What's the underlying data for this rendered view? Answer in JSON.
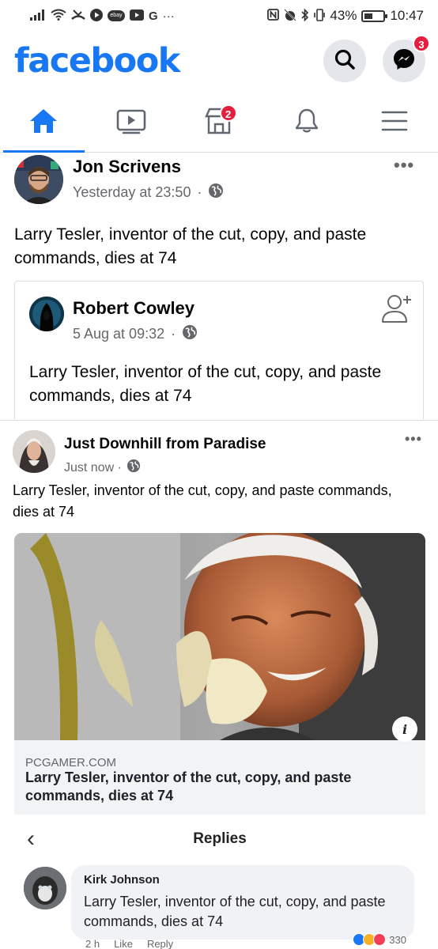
{
  "status_bar": {
    "battery": "43%",
    "time": "10:47",
    "battery_level": 0.43,
    "notification_pill": "ebay",
    "more": "···"
  },
  "header": {
    "logo": "facebook",
    "messenger_badge": "3",
    "brand_color": "#1877f2",
    "badge_color": "#e41e3f"
  },
  "nav": {
    "tabs": [
      {
        "icon": "home-icon",
        "active": true
      },
      {
        "icon": "watch-icon",
        "active": false
      },
      {
        "icon": "marketplace-icon",
        "active": false,
        "badge": "2"
      },
      {
        "icon": "bell-icon",
        "active": false
      },
      {
        "icon": "menu-icon",
        "active": false
      }
    ]
  },
  "post1": {
    "author": "Jon Scrivens",
    "timestamp": "Yesterday at 23:50",
    "dot": "·",
    "text": "Larry Tesler, inventor of the cut, copy, and paste commands, dies at 74",
    "more": "•••"
  },
  "shared": {
    "author": "Robert Cowley",
    "timestamp": "5 Aug at 09:32",
    "dot": "·",
    "text": "Larry Tesler, inventor of the cut, copy, and paste commands, dies at 74"
  },
  "post2": {
    "author": "Just Downhill from Paradise",
    "timestamp": "Just now ·",
    "text": "Larry Tesler, inventor of the cut, copy, and paste commands, dies at 74",
    "more": "•••"
  },
  "link": {
    "domain": "PCGAMER.COM",
    "title": "Larry Tesler, inventor of the cut, copy, and paste commands, dies at 74",
    "info": "i"
  },
  "replies": {
    "title": "Replies",
    "back": "‹",
    "reply": {
      "name": "Kirk Johnson",
      "text": "Larry Tesler, inventor of the cut, copy, and paste commands, dies at 74",
      "time": "2 h",
      "like": "Like",
      "reply_label": "Reply",
      "reaction_count": "330"
    }
  }
}
